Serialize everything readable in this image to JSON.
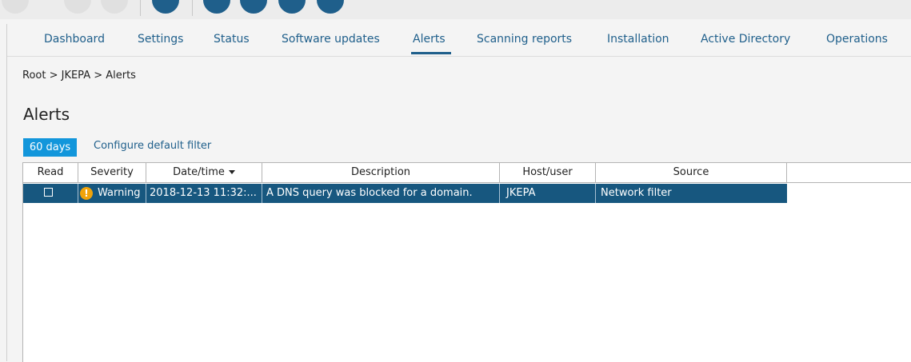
{
  "colors": {
    "accent": "#1f5f8b",
    "selected_row": "#17577f",
    "filter_button": "#1296db",
    "warning": "#f0a30a"
  },
  "nav": {
    "tabs": [
      "Dashboard",
      "Settings",
      "Status",
      "Software updates",
      "Alerts",
      "Scanning reports",
      "Installation",
      "Active Directory",
      "Operations"
    ],
    "active": "Alerts"
  },
  "breadcrumb": "Root > JKEPA > Alerts",
  "page_title": "Alerts",
  "filter": {
    "days_label": "60 days",
    "configure_label": "Configure default filter"
  },
  "table": {
    "columns": [
      "Read",
      "Severity",
      "Date/time",
      "Description",
      "Host/user",
      "Source"
    ],
    "sorted_column": "Date/time",
    "rows": [
      {
        "read": false,
        "severity_icon": "warning-icon",
        "severity": "Warning",
        "datetime": "2018-12-13 11:32:...",
        "description": "A DNS query was blocked for a domain.",
        "host": "JKEPA",
        "source": "Network filter"
      }
    ]
  }
}
